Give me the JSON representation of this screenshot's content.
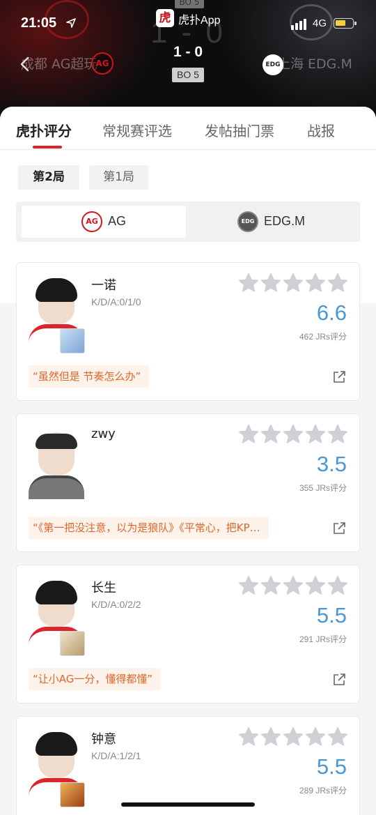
{
  "status_bar": {
    "time": "21:05",
    "network": "4G",
    "app_badge_char": "虎",
    "app_name": "虎扑App"
  },
  "match": {
    "team_left": "成都 AG超玩",
    "team_left_logo_text": "AG",
    "team_right": "上海 EDG.M",
    "team_right_logo_text": "EDG",
    "score": "1 - 0",
    "format": "BO 5",
    "ghost_score": "1 - 0",
    "ghost_format": "BO 5"
  },
  "tabs": [
    {
      "label": "虎扑评分",
      "active": true
    },
    {
      "label": "常规赛评选",
      "active": false
    },
    {
      "label": "发帖抽门票",
      "active": false
    },
    {
      "label": "战报",
      "active": false
    }
  ],
  "rounds": [
    {
      "label": "第2局",
      "active": true
    },
    {
      "label": "第1局",
      "active": false
    }
  ],
  "team_switch": [
    {
      "label": "AG",
      "logo_text": "AG",
      "active": true
    },
    {
      "label": "EDG.M",
      "logo_text": "EDG",
      "active": false
    }
  ],
  "players": [
    {
      "name": "一诺",
      "kda": "K/D/A:0/1/0",
      "score": "6.6",
      "votes": "462 JRs评分",
      "quote": "“虽然但是 节奏怎么办”",
      "hero_color": "#7aa7d8"
    },
    {
      "name": "zwy",
      "kda": "",
      "score": "3.5",
      "votes": "355 JRs评分",
      "quote": "“《第一把没注意，以为是狼队》《平常心，把KP…",
      "hero_color": ""
    },
    {
      "name": "长生",
      "kda": "K/D/A:0/2/2",
      "score": "5.5",
      "votes": "291 JRs评分",
      "quote": "“让小AG一分，懂得都懂”",
      "hero_color": "#d8c7a2"
    },
    {
      "name": "钟意",
      "kda": "K/D/A:1/2/1",
      "score": "5.5",
      "votes": "289 JRs评分",
      "quote": "",
      "hero_color": "#c9702c"
    }
  ],
  "colors": {
    "accent_red": "#d9252b",
    "score_blue": "#4a97d7",
    "quote_orange": "#e0652a",
    "star_gray": "#cfd0d6"
  }
}
